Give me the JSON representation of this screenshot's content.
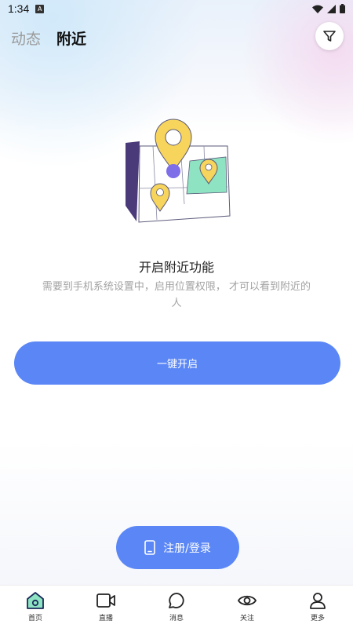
{
  "status_bar": {
    "time": "1:34",
    "notification_badge": "A"
  },
  "tabs": [
    {
      "label": "动态",
      "active": false
    },
    {
      "label": "附近",
      "active": true
    }
  ],
  "filter_icon": "filter-icon",
  "location_prompt": {
    "title": "开启附近功能",
    "description": "需要到手机系统设置中，启用位置权限， 才可以看到附近的人",
    "enable_button": "一键开启"
  },
  "login_button": {
    "label": "注册/登录",
    "icon": "phone-icon"
  },
  "bottom_nav": [
    {
      "label": "首页",
      "icon": "home-icon",
      "active": true
    },
    {
      "label": "直播",
      "icon": "video-camera-icon",
      "active": false
    },
    {
      "label": "消息",
      "icon": "message-bubble-icon",
      "active": false
    },
    {
      "label": "关注",
      "icon": "eye-icon",
      "active": false
    },
    {
      "label": "更多",
      "icon": "person-icon",
      "active": false
    }
  ],
  "colors": {
    "accent": "#5b87f6",
    "map_pin": "#f7d45c",
    "pin_purple": "#7e6ee8",
    "map_green": "#8ee3c2",
    "fold": "#4a3a7a"
  }
}
